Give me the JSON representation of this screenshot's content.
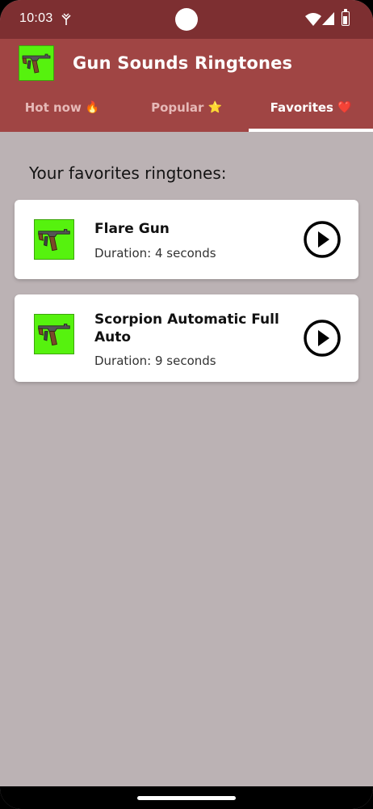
{
  "status_bar": {
    "time": "10:03"
  },
  "app_bar": {
    "title": "Gun Sounds Ringtones",
    "logo_icon": "gun-icon"
  },
  "tabs": [
    {
      "label": "Hot now",
      "emoji": "🔥",
      "active": false
    },
    {
      "label": "Popular",
      "emoji": "⭐",
      "active": false
    },
    {
      "label": "Favorites",
      "emoji": "❤️",
      "active": true
    }
  ],
  "main": {
    "section_title": "Your favorites ringtones:",
    "ringtones": [
      {
        "name": "Flare Gun",
        "duration": "Duration: 4 seconds"
      },
      {
        "name": "Scorpion Automatic Full Auto",
        "duration": "Duration: 9 seconds"
      }
    ]
  },
  "colors": {
    "status_bar": "#7d2f31",
    "app_bar": "#a04544",
    "background": "#bbb2b4",
    "thumb_green": "#56f20e"
  }
}
